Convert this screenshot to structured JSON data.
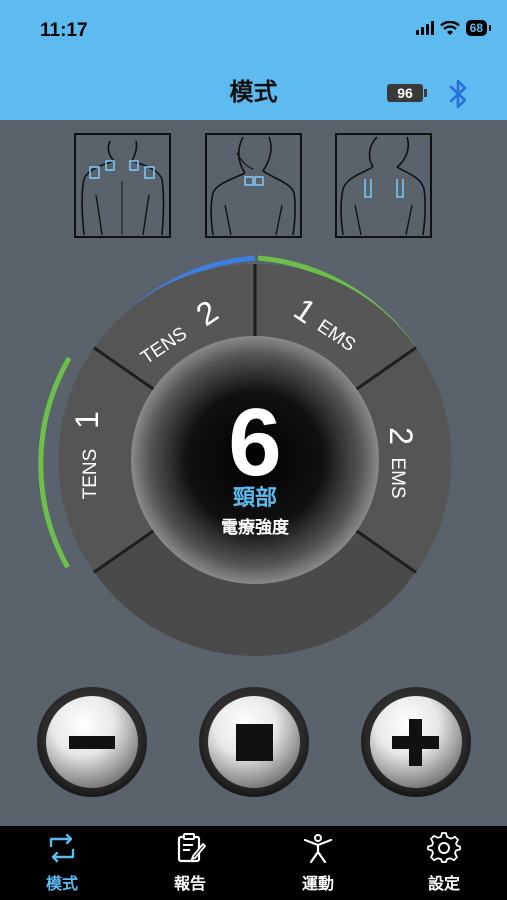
{
  "status_bar": {
    "time": "11:17",
    "battery": "68"
  },
  "nav": {
    "title": "模式",
    "device_battery": "96"
  },
  "dial": {
    "intensity": "6",
    "area": "頸部",
    "caption": "電療強度",
    "segments": [
      {
        "id": "tens1",
        "prefix": "TENS",
        "num": "1"
      },
      {
        "id": "tens2",
        "prefix": "TENS",
        "num": "2"
      },
      {
        "id": "ems1",
        "num": "1",
        "suffix": "EMS"
      },
      {
        "id": "ems2",
        "num": "2",
        "suffix": "EMS"
      }
    ]
  },
  "colors": {
    "accent_blue": "#3d7fe0",
    "accent_green": "#6cc04a",
    "header": "#5dbbf0",
    "pad_marker": "#7ec3f0"
  },
  "body_positions": [
    "neck-shoulders",
    "back-of-neck",
    "upper-back"
  ],
  "controls": [
    "minus",
    "stop",
    "plus"
  ],
  "tabs": [
    {
      "label": "模式",
      "icon": "mode-cycle-icon",
      "active": true
    },
    {
      "label": "報告",
      "icon": "report-clipboard-icon",
      "active": false
    },
    {
      "label": "運動",
      "icon": "exercise-person-icon",
      "active": false
    },
    {
      "label": "設定",
      "icon": "gear-icon",
      "active": false
    }
  ]
}
